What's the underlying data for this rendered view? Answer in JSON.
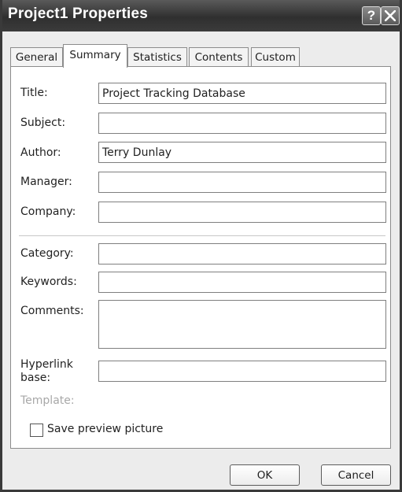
{
  "window": {
    "title": "Project1 Properties",
    "help_glyph": "?",
    "colors": {
      "titlebar": "#3b3b3b",
      "dialog_bg": "#ececec",
      "panel_bg": "#ffffff"
    }
  },
  "tabs": [
    {
      "label": "General",
      "active": false
    },
    {
      "label": "Summary",
      "active": true
    },
    {
      "label": "Statistics",
      "active": false
    },
    {
      "label": "Contents",
      "active": false
    },
    {
      "label": "Custom",
      "active": false
    }
  ],
  "fields": {
    "title": {
      "label": "Title:",
      "value": "Project Tracking Database"
    },
    "subject": {
      "label": "Subject:",
      "value": ""
    },
    "author": {
      "label": "Author:",
      "value": "Terry Dunlay"
    },
    "manager": {
      "label": "Manager:",
      "value": ""
    },
    "company": {
      "label": "Company:",
      "value": ""
    },
    "category": {
      "label": "Category:",
      "value": ""
    },
    "keywords": {
      "label": "Keywords:",
      "value": ""
    },
    "comments": {
      "label": "Comments:",
      "value": ""
    },
    "hyperlink_base": {
      "label_line1": "Hyperlink",
      "label_line2": "base:",
      "value": ""
    },
    "template": {
      "label": "Template:",
      "value": ""
    }
  },
  "save_preview": {
    "label": "Save preview picture",
    "checked": false
  },
  "buttons": {
    "ok": "OK",
    "cancel": "Cancel"
  },
  "icons": {
    "help": "help-icon",
    "close": "close-icon"
  }
}
